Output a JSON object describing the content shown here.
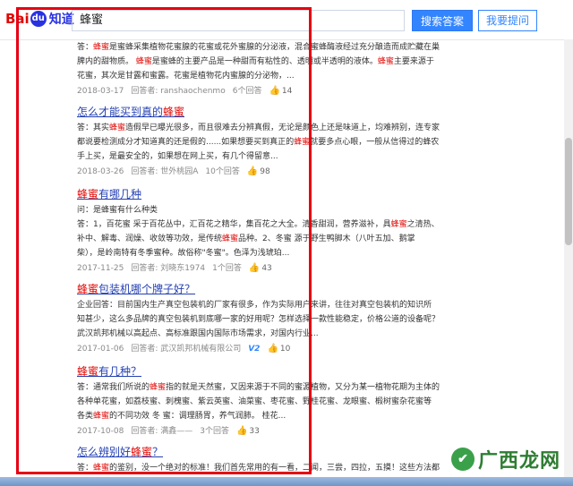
{
  "header": {
    "logo_bai": "Bai",
    "logo_paw": "du",
    "logo_zhidao": "知道",
    "search_value": "蜂蜜",
    "search_button": "搜索答案",
    "ask_button": "我要提问"
  },
  "results": [
    {
      "title": "",
      "lines": [
        "答：蜂蜜是蜜蜂采集植物花蜜腺的花蜜或花外蜜腺的分泌液，混合蜜蜂酶液经过充分酿造而成贮藏在巢",
        "脾内的甜物质。 蜂蜜是蜜蜂的主要产品是一种甜而有粘性的、透明或半透明的液体。蜂蜜主要来源于",
        "花蜜，其次是甘露和蜜露。花蜜是植物花内蜜腺的分泌物，..."
      ],
      "date": "2018-03-17",
      "answerer": "回答者: ranshaochenmo",
      "answers": "6个回答",
      "likes": "14"
    },
    {
      "title": "怎么才能买到真的蜂蜜",
      "lines": [
        "答：其实蜂蜜造假早已曝光很多，而且很难去分辨真假，无论是颜色上还是味道上，均难辨别，连专家",
        "都说要检测成分才知道真的还是假的......如果想要买到真正的蜂蜜就要多点心眼，一般从信得过的蜂农",
        "手上买，是最安全的，如果想在网上买，有几个得留意..."
      ],
      "date": "2018-03-26",
      "answerer": "回答者: 世外桃园A",
      "answers": "10个回答",
      "likes": "98"
    },
    {
      "title": "蜂蜜有哪几种",
      "question": "问：是蜂蜜有什么种类",
      "lines": [
        "答：1，百花蜜 采于百花丛中，汇百花之精华，集百花之大全。清香甜润，营养滋补，具蜂蜜之清热、",
        "补中、解毒、润燥、收敛等功效，是传统蜂蜜品种。2、冬蜜 源于野生鸭脚木（八叶五加、鹅掌",
        "柴），是岭南特有冬季蜜种。故俗称\"冬蜜\"。色泽为浅琥珀..."
      ],
      "date": "2017-11-25",
      "answerer": "回答者: 刘晓东1974",
      "answers": "1个回答",
      "likes": "43"
    },
    {
      "title": "蜂蜜包装机哪个牌子好？",
      "lines": [
        "企业回答：目前国内生产真空包装机的厂家有很多，作为实际用户来讲，往往对真空包装机的知识所",
        "知甚少，这么多品牌的真空包装机到底哪一家的好用呢？怎样选择一款性能稳定，价格公道的设备呢？",
        "武汉凯邦机械以高起点、高标准跟国内国际市场需求，对国内行业..."
      ],
      "date": "2017-01-06",
      "answerer": "回答者: 武汉凯邦机械有限公司",
      "badge": "V2",
      "likes": "10"
    },
    {
      "title": "蜂蜜有几种？",
      "lines": [
        "答：通常我们所说的蜂蜜指的就是天然蜜，又因来源于不同的蜜源植物，又分为某一植物花期为主体的",
        "各种单花蜜，如荔枝蜜、刺槐蜜、紫云英蜜、油菜蜜、枣花蜜、野桂花蜜、龙眼蜜、椴树蜜杂花蜜等",
        "各类蜂蜜的不同功效 冬 蜜：调理肠胃，养气润肺。 桂花..."
      ],
      "date": "2017-10-08",
      "answerer": "回答者: 满鑫——",
      "answers": "3个回答",
      "likes": "33"
    },
    {
      "title": "怎么辨别好蜂蜜？",
      "lines": [
        "答：蜂蜜的鉴别，没一个绝对的标准！我们首先常用的有一看，二闻，三尝，四拉，五摸！这些方法都"
      ]
    }
  ],
  "watermark": {
    "text": "广西龙网"
  },
  "colors": {
    "frame": "#e60012",
    "link": "#2440b3",
    "highlight": "#e10602",
    "button": "#3385ff"
  }
}
